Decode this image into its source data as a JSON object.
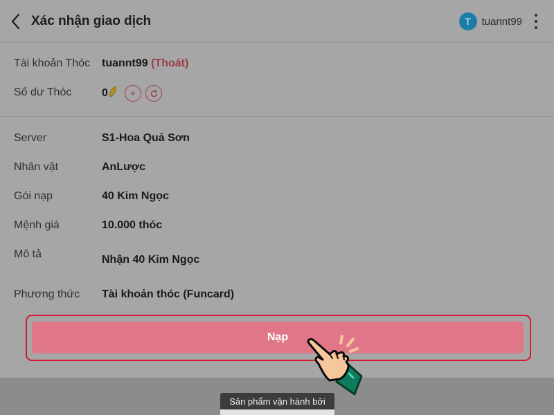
{
  "header": {
    "title": "Xác nhận giao dịch",
    "avatar_initial": "T",
    "username": "tuannt99"
  },
  "account": {
    "label": "Tài khoản Thóc",
    "value": "tuannt99",
    "logout": "(Thoát)",
    "balance_label": "Số dư Thóc",
    "balance_value": "0"
  },
  "details": {
    "server_label": "Server",
    "server_value": "S1-Hoa Quả Sơn",
    "character_label": "Nhân vật",
    "character_value": "AnLược",
    "package_label": "Gói nạp",
    "package_value": "40 Kim Ngọc",
    "price_label": "Mệnh giá",
    "price_value": "10.000 thóc",
    "desc_label": "Mô tả",
    "desc_value": "Nhận 40 Kim Ngọc",
    "method_label": "Phương thức",
    "method_value": "Tài khoản thóc (Funcard)"
  },
  "actions": {
    "submit_label": "Nạp"
  },
  "footer": {
    "tooltip": "Sản phẩm vận hành bởi"
  },
  "colors": {
    "accent": "#e07788",
    "highlight_frame": "#d8182e",
    "avatar": "#1b7ea8"
  }
}
